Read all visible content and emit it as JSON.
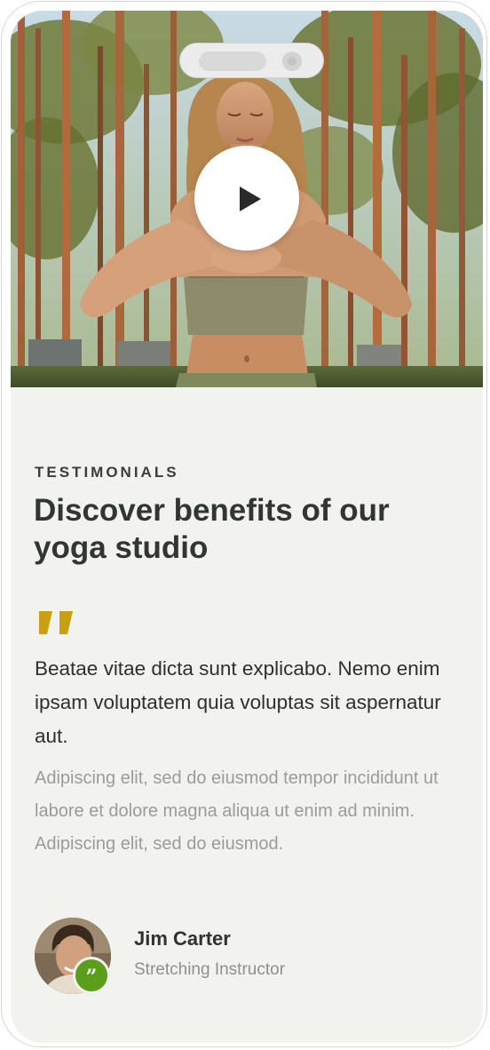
{
  "hero": {
    "image_alt": "woman meditating in pine forest",
    "play_icon": "play-icon"
  },
  "testimonials": {
    "eyebrow": "TESTIMONIALS",
    "headline": "Discover benefits of our yoga studio",
    "quote_icon": "quote-icon",
    "quote_color": "#c9a011",
    "lead": "Beatae vitae dicta sunt explicabo. Nemo enim ipsam voluptatem quia voluptas sit aspernatur aut.",
    "body": "Adipiscing elit, sed do eiusmod tempor incididunt ut labore et dolore magna aliqua ut enim ad minim. Adipiscing elit, sed do eiusmod.",
    "author": {
      "name": "Jim Carter",
      "role": "Stretching Instructor",
      "badge_glyph": "”",
      "badge_color": "#5a9e1c"
    }
  },
  "theme": {
    "background": "#f2f3ee",
    "text_dark": "#323530",
    "text_muted": "#9a9d97"
  }
}
